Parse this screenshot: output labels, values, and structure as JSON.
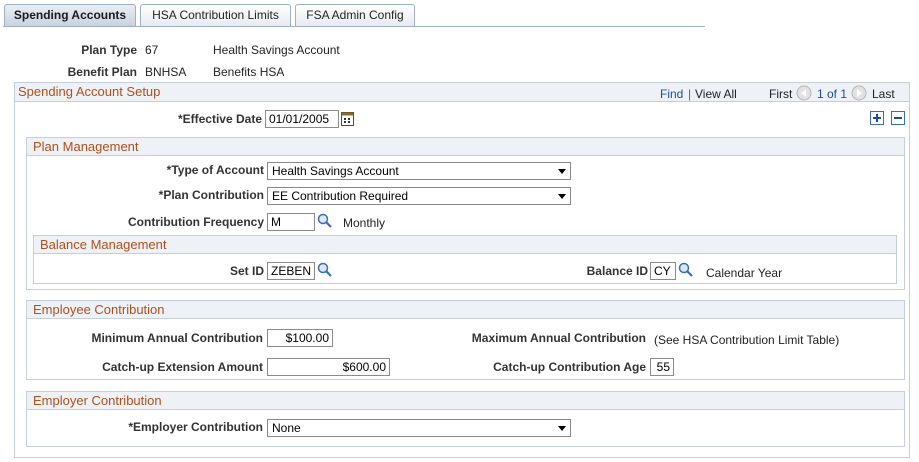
{
  "tabs": [
    {
      "label": "Spending Accounts",
      "active": true
    },
    {
      "label": "HSA Contribution Limits",
      "active": false
    },
    {
      "label": "FSA Admin Config",
      "active": false
    }
  ],
  "plan_type": {
    "label": "Plan Type",
    "code": "67",
    "description": "Health Savings Account"
  },
  "benefit_plan": {
    "label": "Benefit Plan",
    "code": "BNHSA",
    "description": "Benefits HSA"
  },
  "setup": {
    "title": "Spending Account Setup",
    "find": "Find",
    "separator": "|",
    "view_all": "View All",
    "first": "First",
    "counter": "1 of 1",
    "last": "Last",
    "effective_date": {
      "label": "*Effective Date",
      "value": "01/01/2005"
    }
  },
  "plan_management": {
    "title": "Plan Management",
    "type_of_account": {
      "label": "*Type of Account",
      "value": "Health Savings Account"
    },
    "plan_contribution": {
      "label": "*Plan Contribution",
      "value": "EE Contribution Required"
    },
    "contribution_frequency": {
      "label": "Contribution Frequency",
      "value": "M",
      "description": "Monthly"
    },
    "balance_management": {
      "title": "Balance Management",
      "set_id": {
        "label": "Set ID",
        "value": "ZEBEN"
      },
      "balance_id": {
        "label": "Balance ID",
        "value": "CY",
        "description": "Calendar Year"
      }
    }
  },
  "employee_contribution": {
    "title": "Employee Contribution",
    "minimum_annual": {
      "label": "Minimum Annual Contribution",
      "value": "$100.00"
    },
    "maximum_annual": {
      "label": "Maximum Annual Contribution",
      "value": "(See HSA Contribution Limit Table)"
    },
    "catchup_amount": {
      "label": "Catch-up Extension Amount",
      "value": "$600.00"
    },
    "catchup_age": {
      "label": "Catch-up Contribution Age",
      "value": "55"
    }
  },
  "employer_contribution": {
    "title": "Employer Contribution",
    "employer": {
      "label": "*Employer Contribution",
      "value": "None"
    }
  },
  "colors": {
    "header_text": "#b0501c",
    "link": "#1b4fa0",
    "border": "#c6ced8"
  }
}
